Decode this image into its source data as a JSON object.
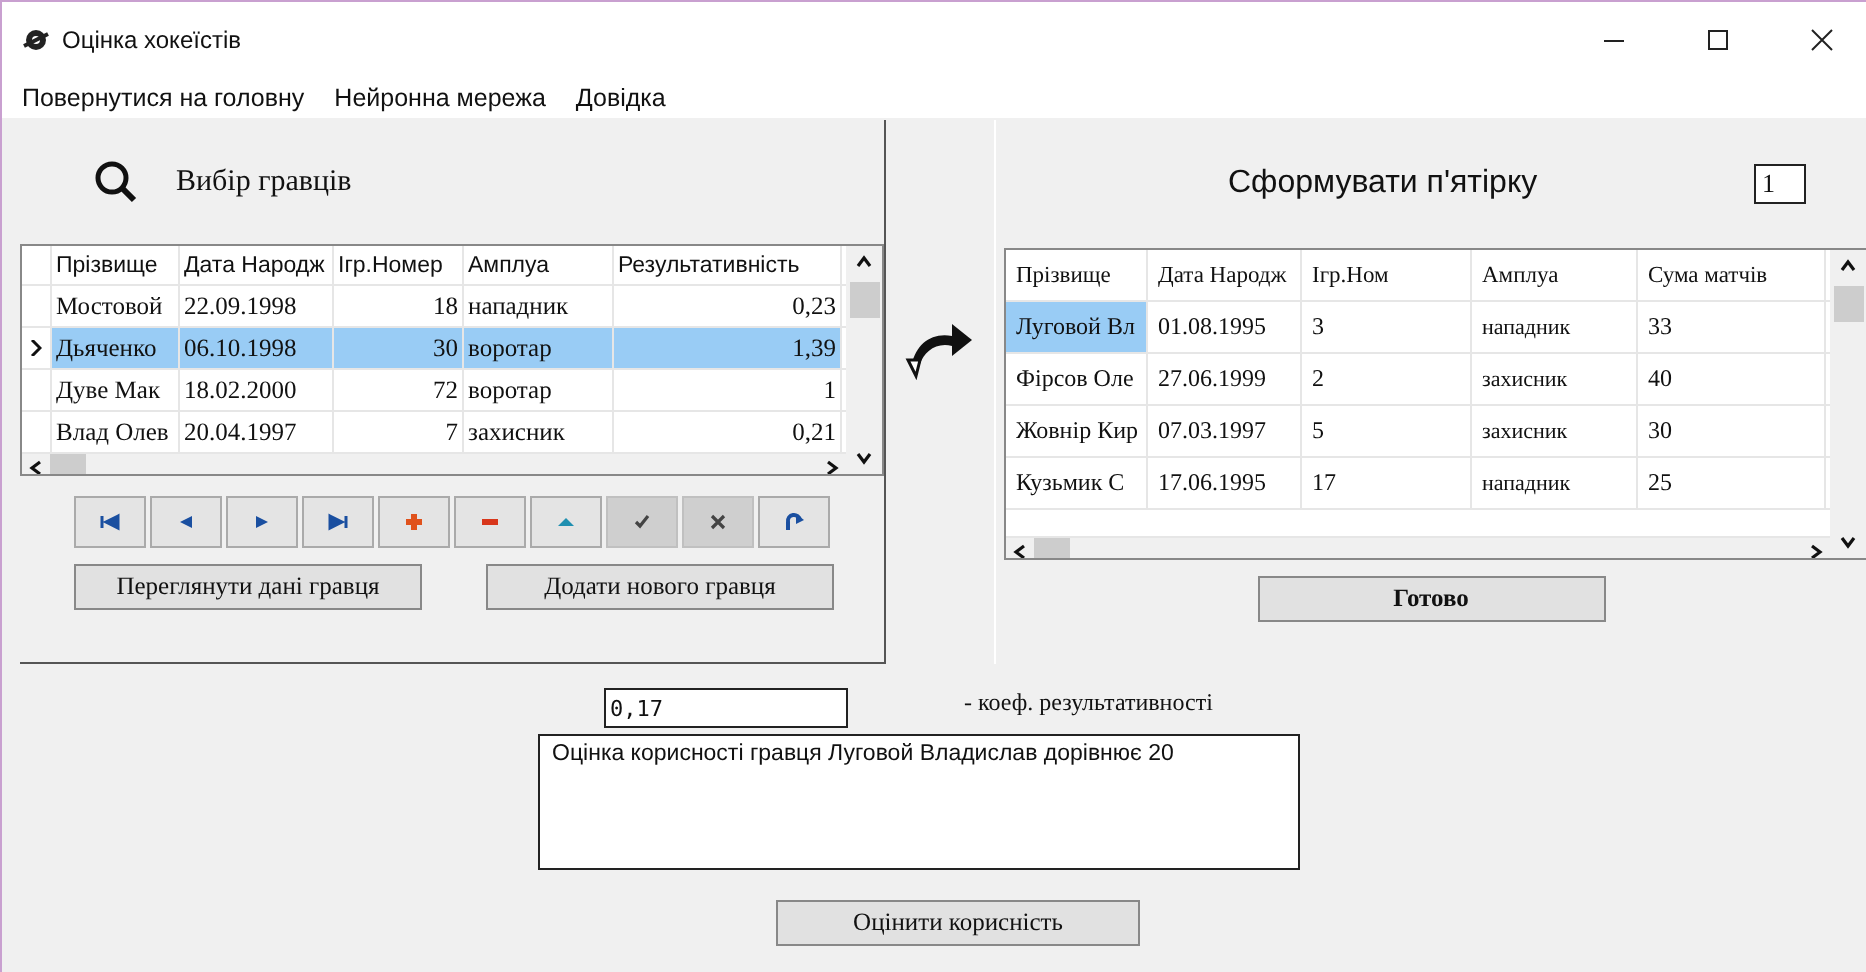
{
  "window": {
    "title": "Оцінка хокеїстів"
  },
  "menu": [
    "Повернутися на головну",
    "Нейронна мережа",
    "Довідка"
  ],
  "players_panel": {
    "title": "Вибір гравців",
    "table": {
      "columns": [
        "Прізвище",
        "Дата Народж",
        "Ігр.Номер",
        "Амплуа",
        "Результативність"
      ],
      "rows": [
        {
          "cells": [
            "Мостовой",
            "22.09.1998",
            "18",
            "нападник",
            "0,23"
          ],
          "selected": false
        },
        {
          "cells": [
            "Дьяченко",
            "06.10.1998",
            "30",
            "воротар",
            "1,39"
          ],
          "selected": true
        },
        {
          "cells": [
            "Дуве Мак",
            "18.02.2000",
            "72",
            "воротар",
            "1"
          ],
          "selected": false
        },
        {
          "cells": [
            "Влад Олев",
            "20.04.1997",
            "7",
            "захисник",
            "0,21"
          ],
          "selected": false
        }
      ]
    },
    "navigator": [
      {
        "kind": "first",
        "disabled": false
      },
      {
        "kind": "prior",
        "disabled": false
      },
      {
        "kind": "next",
        "disabled": false
      },
      {
        "kind": "last",
        "disabled": false
      },
      {
        "kind": "insert",
        "disabled": false
      },
      {
        "kind": "delete",
        "disabled": false
      },
      {
        "kind": "edit",
        "disabled": false
      },
      {
        "kind": "post",
        "disabled": true
      },
      {
        "kind": "cancel",
        "disabled": true
      },
      {
        "kind": "refresh",
        "disabled": false
      }
    ],
    "buttons": [
      "Переглянути дані гравця",
      "Додати нового гравця"
    ]
  },
  "team_panel": {
    "title": "Сформувати п'ятірку",
    "number": "1",
    "table": {
      "columns": [
        "Прізвище",
        "Дата Народж",
        "Ігр.Ном",
        "Амплуа",
        "Сума матчів"
      ],
      "rows": [
        {
          "cells": [
            "Луговой Вл",
            "01.08.1995",
            "3",
            "нападник",
            "33"
          ],
          "selected": true
        },
        {
          "cells": [
            "Фірсов  Оле",
            "27.06.1999",
            "2",
            "захисник",
            "40"
          ],
          "selected": false
        },
        {
          "cells": [
            "Жовнір Кир",
            "07.03.1997",
            "5",
            "захисник",
            "30"
          ],
          "selected": false
        },
        {
          "cells": [
            " Кузьмик С",
            "17.06.1995",
            "17",
            "нападник",
            "25"
          ],
          "selected": false
        }
      ]
    },
    "button": "Готово"
  },
  "coefficient": {
    "value": "0,17",
    "label": "- коеф. результативності"
  },
  "result_text": "Оцінка корисності гравця Луговой Владислав дорівнює 20",
  "evaluate_button": "Оцінити корисність"
}
